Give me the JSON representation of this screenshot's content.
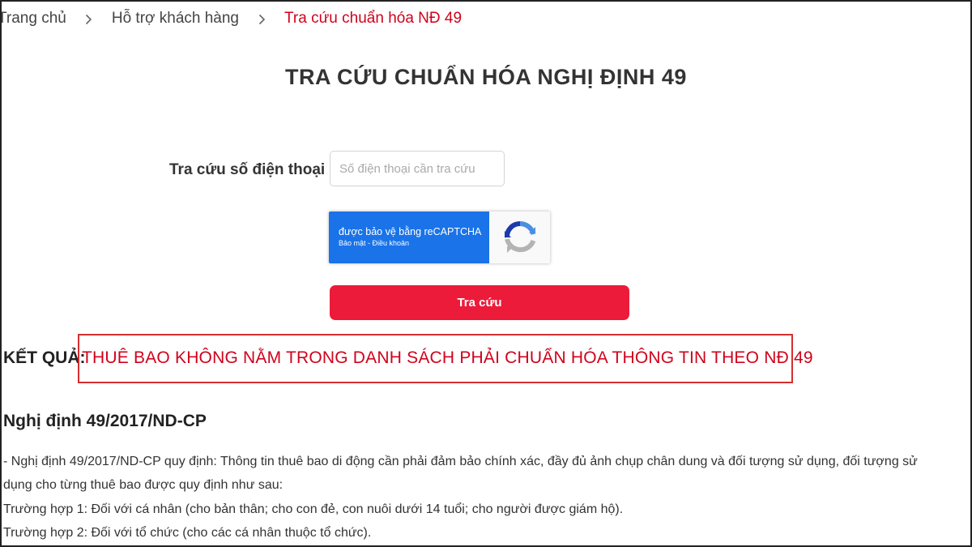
{
  "breadcrumb": {
    "items": [
      {
        "label": "Trang chủ"
      },
      {
        "label": "Hỗ trợ khách hàng"
      },
      {
        "label": "Tra cứu chuẩn hóa NĐ 49"
      }
    ]
  },
  "page": {
    "title": "TRA CỨU CHUẨN HÓA NGHỊ ĐỊNH 49"
  },
  "form": {
    "phone_label": "Tra cứu số điện thoại",
    "phone_placeholder": "Số điện thoại cần tra cứu",
    "phone_value": "",
    "submit_label": "Tra cứu"
  },
  "recaptcha": {
    "main_text": "được bảo vệ bằng reCAPTCHA",
    "privacy_label": "Bảo mật",
    "separator": " - ",
    "terms_label": "Điều khoản"
  },
  "result": {
    "label": "KẾT QUẢ:",
    "value": "THUÊ BAO KHÔNG NẰM TRONG DANH SÁCH PHẢI CHUẨN HÓA THÔNG TIN THEO NĐ 49"
  },
  "info": {
    "heading": "Nghị định 49/2017/ND-CP",
    "paragraph_line1": "- Nghị định 49/2017/ND-CP quy định: Thông tin thuê bao di động cần phải đảm bảo chính xác, đầy đủ ảnh chụp chân dung và đối tượng sử dụng, đối tượng sử",
    "paragraph_line2": "dụng cho từng thuê bao được quy định như sau:",
    "case1": "Trường hợp 1: Đối với cá nhân (cho bản thân; cho con đẻ, con nuôi dưới 14 tuổi; cho người được giám hộ).",
    "case2": "Trường hợp 2: Đối với tổ chức (cho các cá nhân thuộc tổ chức)."
  },
  "colors": {
    "accent_red": "#ed1b3a",
    "breadcrumb_active": "#d0021b",
    "recaptcha_blue": "#1a73e8",
    "result_border": "#d32f2f"
  },
  "icons": {
    "breadcrumb_separator": "chevron-right-icon",
    "recaptcha_logo": "recaptcha-logo-icon"
  }
}
